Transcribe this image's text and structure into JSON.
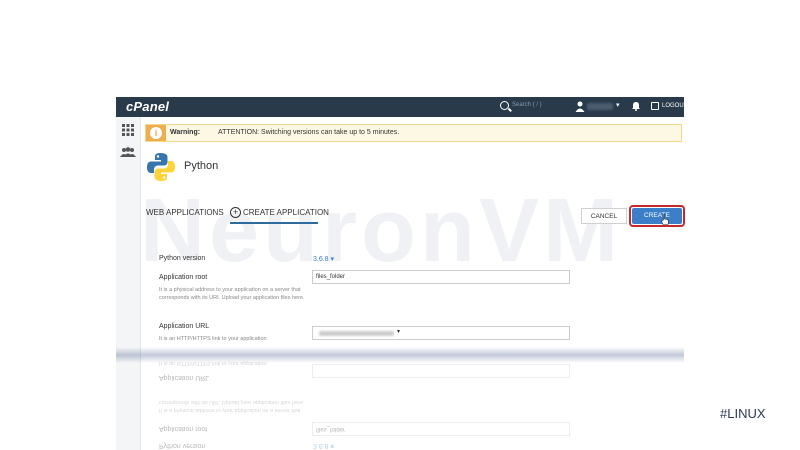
{
  "topbar": {
    "logo": "cPanel",
    "search_placeholder": "Search ( / )",
    "logout_label": "LOGOUT"
  },
  "warning": {
    "label": "Warning:",
    "text": "ATTENTION: Switching versions can take up to 5 minutes."
  },
  "page": {
    "title": "Python",
    "watermark": "NeuronVM"
  },
  "tabs": {
    "web_applications": "WEB APPLICATIONS",
    "create_application": "CREATE APPLICATION"
  },
  "actions": {
    "cancel_label": "CANCEL",
    "create_label": "CREATE"
  },
  "form": {
    "python_version": {
      "label": "Python version",
      "value": "3.6.8 ▾"
    },
    "application_root": {
      "label": "Application root",
      "value": "files_folder",
      "help": "It is a physical address to your application on a server that corresponds with its URI. Upload your application files here."
    },
    "application_url": {
      "label": "Application URL",
      "help": "It is an HTTP/HTTPS link to your application"
    }
  },
  "overlay": {
    "hashtag": "#LINUX"
  },
  "colors": {
    "topbar": "#293a4a",
    "accent": "#3a7fc7",
    "warning": "#f0ad4e",
    "highlight_ring": "#c6282f"
  }
}
